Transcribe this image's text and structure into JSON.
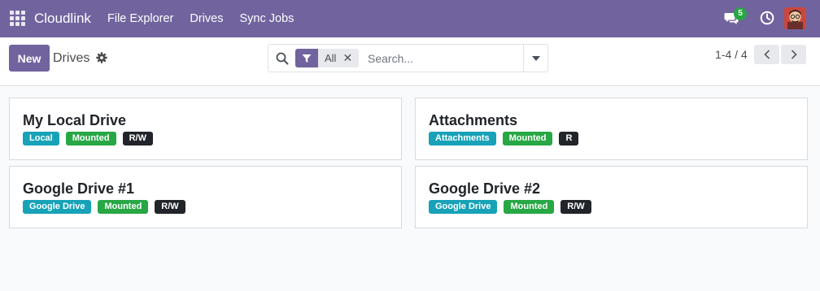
{
  "navbar": {
    "brand": "Cloudlink",
    "menu": [
      "File Explorer",
      "Drives",
      "Sync Jobs"
    ],
    "chat_count": "5",
    "bg_color": "#71639e"
  },
  "control": {
    "new_label": "New",
    "title": "Drives",
    "search": {
      "facet_label": "All",
      "placeholder": "Search..."
    },
    "pager": "1-4 / 4"
  },
  "cards": [
    {
      "title": "My Local Drive",
      "tags": [
        "Local",
        "Mounted",
        "R/W"
      ]
    },
    {
      "title": "Attachments",
      "tags": [
        "Attachments",
        "Mounted",
        "R"
      ]
    },
    {
      "title": "Google Drive #1",
      "tags": [
        "Google Drive",
        "Mounted",
        "R/W"
      ]
    },
    {
      "title": "Google Drive #2",
      "tags": [
        "Google Drive",
        "Mounted",
        "R/W"
      ]
    }
  ],
  "colors": {
    "type_tag": "#17a2b8",
    "status_tag": "#28a745",
    "mode_tag": "#212529"
  }
}
